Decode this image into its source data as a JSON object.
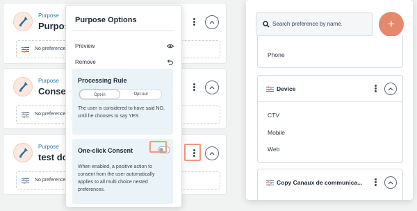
{
  "purposes": [
    {
      "type": "Purpose",
      "name": "Purpose title",
      "no_pref": "No preference added"
    },
    {
      "type": "Purpose",
      "name": "Consent preference",
      "no_pref": "No preference added"
    },
    {
      "type": "Purpose",
      "name": "test doc",
      "no_pref": "No preference added"
    }
  ],
  "menu": {
    "title": "Purpose Options",
    "preview": "Preview",
    "remove": "Remove",
    "processing": {
      "title": "Processing Rule",
      "opt_in": "Opt-in",
      "opt_out": "Opt-out",
      "desc": "The user is considered to have said NO, until he chooses to say YES."
    },
    "one_click": {
      "title": "One-click Consent",
      "enabled": false,
      "desc": "When enabled, a positive action to consent from the user automatically applies to all multi choice nested preferences."
    }
  },
  "panel": {
    "search_placeholder": "Search preference by name.",
    "add_label": "+",
    "first_item": "Phone",
    "device": {
      "name": "Device",
      "items": [
        "CTV",
        "Mobile",
        "Web"
      ]
    },
    "canaux": {
      "name": "Copy Canaux de communica..."
    }
  },
  "colors": {
    "accent": "#e5896d",
    "link": "#2c7ea8",
    "info_box": "#eaf3f8"
  },
  "icons": [
    "wrench-icon",
    "kebab-icon",
    "chevron-up-icon",
    "sliders-icon",
    "eye-icon",
    "undo-icon",
    "search-icon",
    "plus-icon"
  ]
}
